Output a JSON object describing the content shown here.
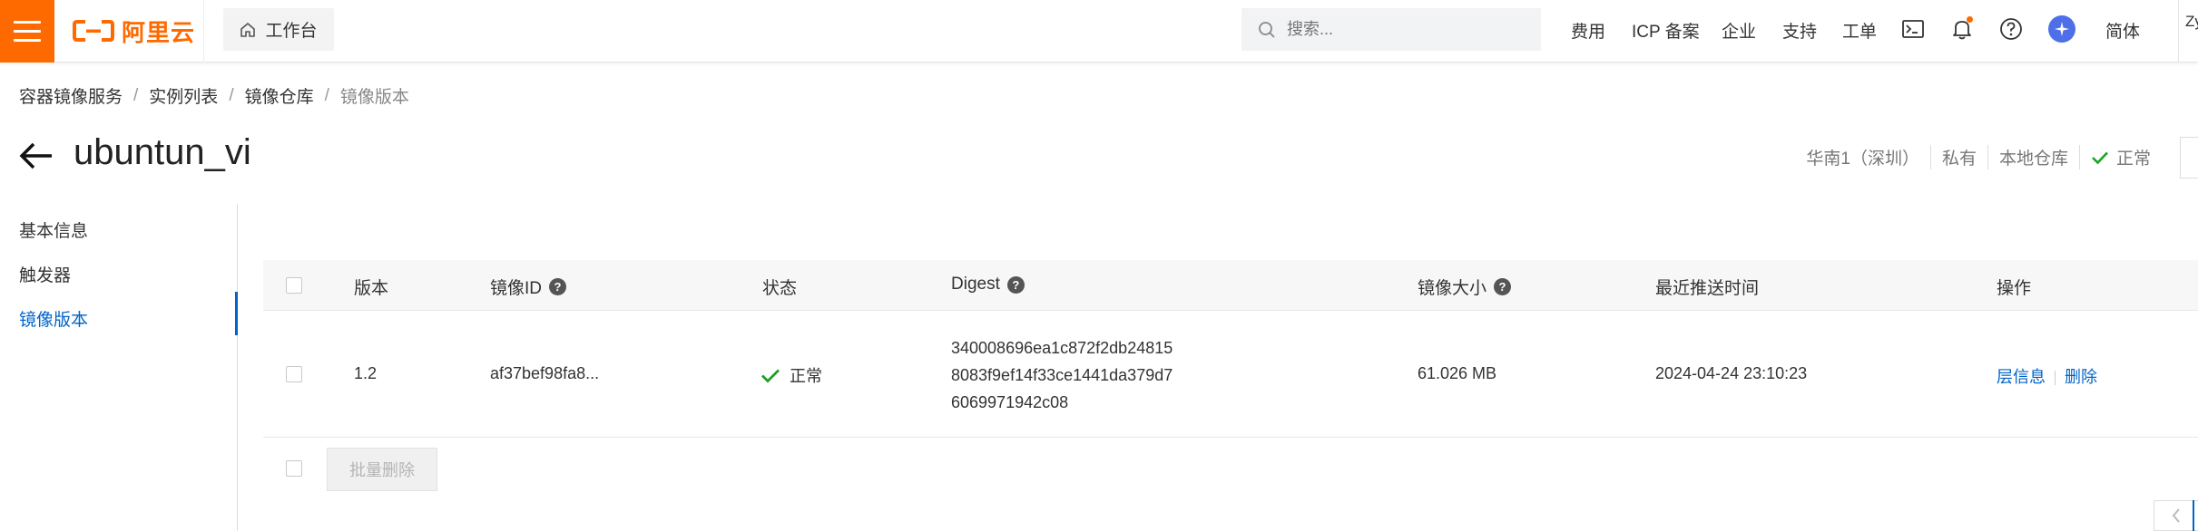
{
  "topbar": {
    "logo_text": "阿里云",
    "workbench_label": "工作台",
    "search_placeholder": "搜索...",
    "links": [
      "费用",
      "ICP 备案",
      "企业",
      "支持",
      "工单"
    ],
    "lang_label": "简体",
    "user_initials": "Zy"
  },
  "breadcrumb": [
    "容器镜像服务",
    "实例列表",
    "镜像仓库",
    "镜像版本"
  ],
  "page": {
    "title": "ubuntun_vi",
    "meta": {
      "region": "华南1（深圳）",
      "visibility": "私有",
      "repo_type": "本地仓库",
      "status": "正常"
    }
  },
  "sidebar": {
    "items": [
      {
        "label": "基本信息",
        "active": false
      },
      {
        "label": "触发器",
        "active": false
      },
      {
        "label": "镜像版本",
        "active": true
      }
    ]
  },
  "table": {
    "columns": [
      "版本",
      "镜像ID",
      "状态",
      "Digest",
      "镜像大小",
      "最近推送时间",
      "操作"
    ],
    "rows": [
      {
        "version": "1.2",
        "image_id": "af37bef98fa8...",
        "status": "正常",
        "digest_lines": [
          "340008696ea1c872f2db24815",
          "8083f9ef14f33ce1441da379d7",
          "6069971942c08"
        ],
        "size": "61.026 MB",
        "pushed_at": "2024-04-24 23:10:23",
        "actions": [
          "层信息",
          "删除"
        ]
      }
    ],
    "batch_delete_label": "批量删除"
  },
  "colors": {
    "brand": "#ff6a00",
    "link": "#0064c8",
    "success": "#1aa321"
  },
  "icons": [
    "menu-icon",
    "home-icon",
    "search-icon",
    "terminal-icon",
    "bell-icon",
    "help-icon",
    "back-arrow-icon",
    "check-icon",
    "question-icon",
    "chevron-left-icon"
  ]
}
